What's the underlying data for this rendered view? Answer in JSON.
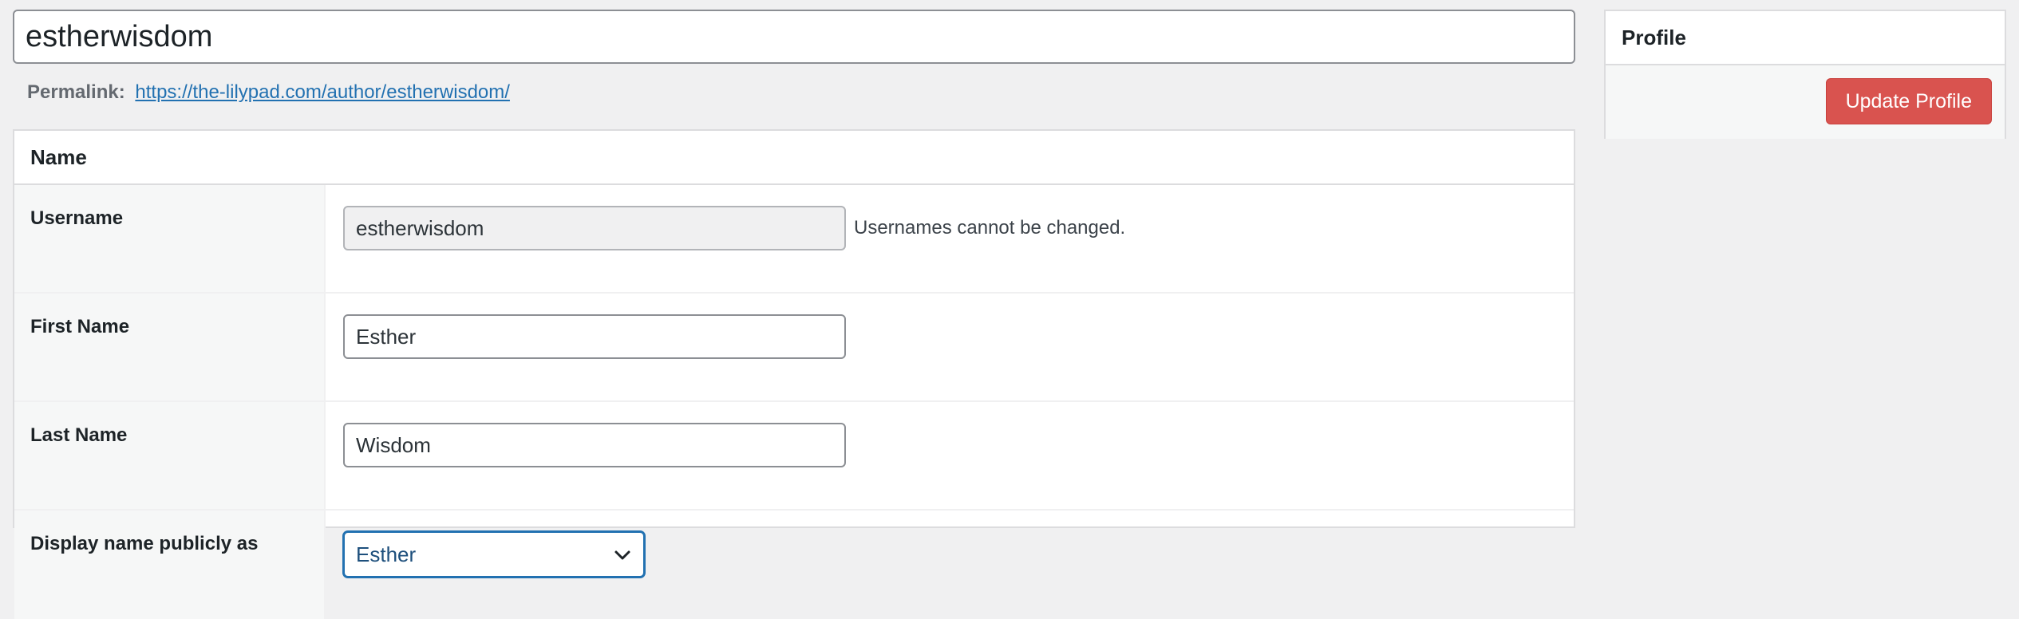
{
  "page": {
    "title_value": "estherwisdom",
    "permalink_label": "Permalink:",
    "permalink_url": "https://the-lilypad.com/author/estherwisdom/"
  },
  "name_section": {
    "heading": "Name",
    "username": {
      "label": "Username",
      "value": "estherwisdom",
      "description": "Usernames cannot be changed."
    },
    "first_name": {
      "label": "First Name",
      "value": "Esther"
    },
    "last_name": {
      "label": "Last Name",
      "value": "Wisdom"
    },
    "display_name": {
      "label": "Display name publicly as",
      "selected": "Esther"
    }
  },
  "profile_box": {
    "heading": "Profile",
    "update_label": "Update Profile"
  },
  "colors": {
    "accent": "#2271b1",
    "update_button": "#d9534f",
    "background": "#f0f0f1"
  },
  "icons": {
    "select_arrow": "chevron-down-icon"
  }
}
